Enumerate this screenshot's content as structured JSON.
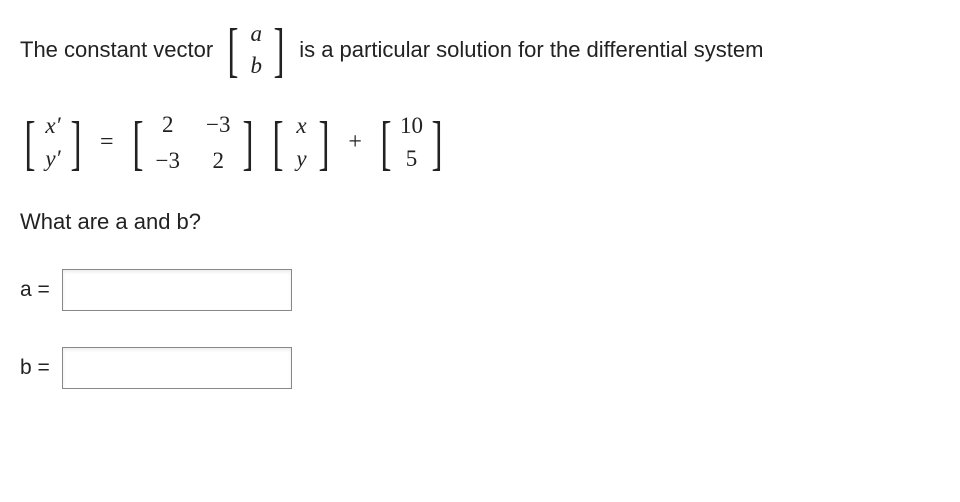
{
  "row1": {
    "text_before": "The constant vector",
    "vec_top": "a",
    "vec_bottom": "b",
    "text_after": "is a particular solution for the differential system"
  },
  "eqline": {
    "lhs_top": "x′",
    "lhs_bottom": "y′",
    "equals": "=",
    "A": {
      "r1c1": "2",
      "r1c2": "−3",
      "r2c1": "−3",
      "r2c2": "2"
    },
    "xvec_top": "x",
    "xvec_bottom": "y",
    "plus": "+",
    "f_top": "10",
    "f_bottom": "5"
  },
  "question": "What are a and b?",
  "answers": {
    "a_label": "a =",
    "a_value": "",
    "b_label": "b =",
    "b_value": ""
  }
}
